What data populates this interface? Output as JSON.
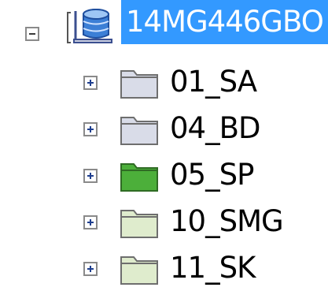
{
  "tree": {
    "root": {
      "label": "14MG446GBO",
      "icon": "database-icon",
      "expanded": true,
      "selected": true,
      "highlight_color": "#3399ff"
    },
    "children": [
      {
        "label": "01_SA",
        "folder_color": "#d9dce8",
        "icon": "folder-icon"
      },
      {
        "label": "04_BD",
        "folder_color": "#d9dce8",
        "icon": "folder-icon"
      },
      {
        "label": "05_SP",
        "folder_color": "#4caf3a",
        "icon": "folder-icon"
      },
      {
        "label": "10_SMG",
        "folder_color": "#dfeccd",
        "icon": "folder-icon"
      },
      {
        "label": "11_SK",
        "folder_color": "#dfeccd",
        "icon": "folder-icon"
      }
    ]
  }
}
